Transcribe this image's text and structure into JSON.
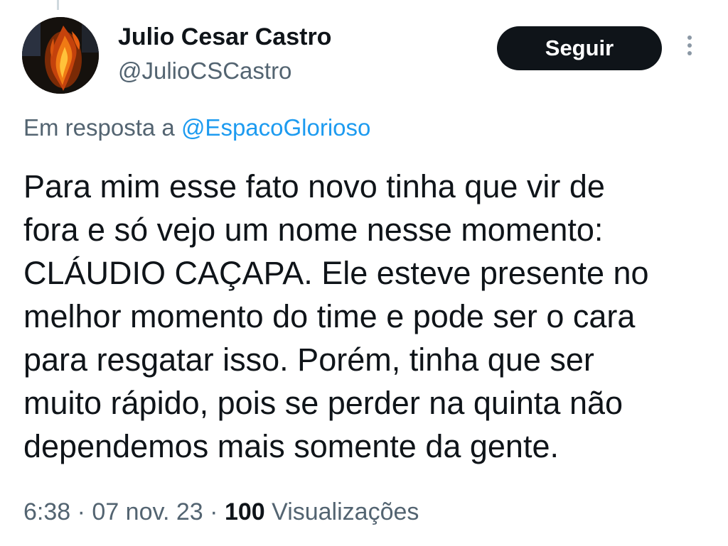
{
  "author": {
    "name": "Julio Cesar Castro",
    "handle": "@JulioCSCastro"
  },
  "header": {
    "follow_label": "Seguir",
    "more_icon": "more-vertical-icon"
  },
  "reply": {
    "prefix": "Em resposta a",
    "mention": "@EspacoGlorioso"
  },
  "tweet": {
    "lines": [
      "Para mim esse fato novo tinha que vir de",
      "fora e só vejo um nome nesse momento:",
      "CLÁUDIO CAÇAPA. Ele esteve presente no",
      "melhor momento do time e pode ser o cara",
      "para resgatar isso. Porém, tinha que ser",
      "muito rápido, pois se perder na quinta não",
      "dependemos mais somente da gente."
    ]
  },
  "meta": {
    "time": "6:38",
    "date": "07 nov. 23",
    "views_count": "100",
    "views_label": "Visualizações",
    "separator": "·"
  },
  "colors": {
    "text": "#0f1419",
    "secondary": "#536471",
    "link": "#1d9bf0",
    "button_bg": "#0f1419"
  }
}
